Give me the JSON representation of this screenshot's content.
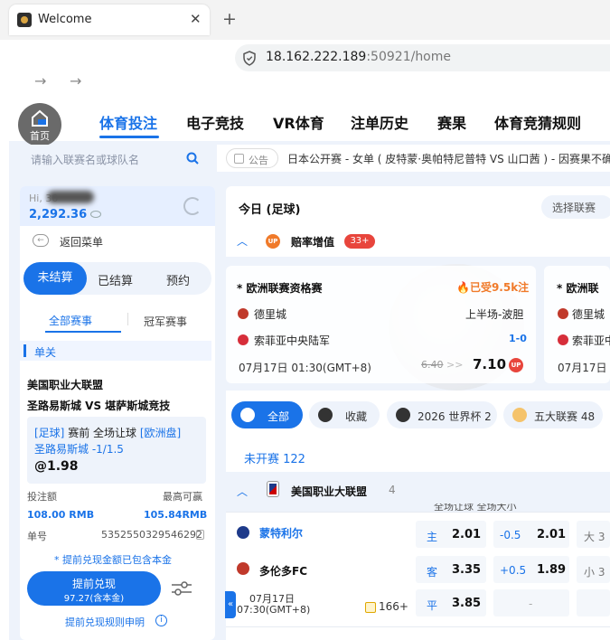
{
  "browser": {
    "tab_title": "Welcome",
    "url_host": "18.162.222.189",
    "url_port_path": ":50921/home"
  },
  "nav": {
    "home_label": "首页",
    "items": [
      "体育投注",
      "电子竞技",
      "VR体育",
      "注单历史",
      "赛果",
      "体育竞猜规则"
    ]
  },
  "search": {
    "placeholder": "请输入联赛名或球队名"
  },
  "account": {
    "greeting": "Hi, 30",
    "balance": "2,292.36"
  },
  "sidebar": {
    "back_label": "返回菜单",
    "segments": [
      "未结算",
      "已结算",
      "预约"
    ],
    "sub_tabs": [
      "全部赛事",
      "冠军赛事"
    ],
    "section_label": "单关"
  },
  "bet": {
    "league": "美国职业大联盟",
    "match": "圣路易斯城 VS 堪萨斯城竞技",
    "sport_tag": "[足球]",
    "detail": " 赛前 全场让球 ",
    "market_tag": "[欧洲盘]",
    "selection": "圣路易斯城 -1/1.5",
    "odds": "@1.98",
    "stake_label": "投注额",
    "max_win_label": "最高可赢",
    "stake": "108.00 RMB",
    "max_win": "105.84RMB",
    "order_label": "单号",
    "order_no": "5352550329546292",
    "cashout_note": "* 提前兑现金额已包含本金",
    "cashout_button": "提前兑现",
    "cashout_amount": "97.27(含本金)",
    "cashout_rule": "提前兑现规则申明"
  },
  "notice": {
    "badge": "公告",
    "text": "日本公开赛 - 女单 ( 皮特蒙·奥帕特尼普特 VS 山口茜 ) - 因赛果不确"
  },
  "main": {
    "title": "今日 (足球)",
    "select_league": "选择联赛",
    "boost_label": "赔率增值",
    "boost_count": "33+",
    "featured": [
      {
        "league": "* 欧洲联赛资格赛",
        "popularity": "🔥已受9.5k注",
        "home": "德里城",
        "away": "索菲亚中央陆军",
        "status": "上半场-波胆",
        "score": "1-0",
        "time": "07月17日 01:30(GMT+8)",
        "old_odds": "6.40",
        "arrow": ">>",
        "new_odds": "7.10",
        "badge": "UP"
      },
      {
        "league": "* 欧洲联",
        "home": "德里城",
        "away": "索菲亚中",
        "time": "07月17日"
      }
    ],
    "filters": [
      {
        "label": "全部",
        "icon": "grid-icon"
      },
      {
        "label": "收藏",
        "icon": "star-icon"
      },
      {
        "label": "2026 世界杯 2",
        "icon": "trophy-icon"
      },
      {
        "label": "五大联赛 48",
        "icon": "mascot-icon"
      }
    ],
    "not_started": "未开赛 122",
    "league_group": {
      "name": "美国职业大联盟",
      "count": "4",
      "hidden_header": "全场让球 全场大小"
    },
    "match": {
      "home": "蒙特利尔",
      "away": "多伦多FC",
      "date": "07月17日",
      "time": "07:30(GMT+8)",
      "more_markets": "166+",
      "rows": [
        {
          "label": "主",
          "win": "2.01",
          "hcp": "-0.5",
          "hcp_odds": "2.01",
          "ou": "大 3"
        },
        {
          "label": "客",
          "win": "3.35",
          "hcp": "+0.5",
          "hcp_odds": "1.89",
          "ou": "小 3"
        },
        {
          "label": "平",
          "win": "3.85",
          "hcp": "-",
          "hcp_odds": "",
          "ou": ""
        }
      ]
    }
  },
  "colors": {
    "accent": "#1a73e8",
    "hot": "#f07a2a",
    "badge_red": "#e8453c"
  }
}
